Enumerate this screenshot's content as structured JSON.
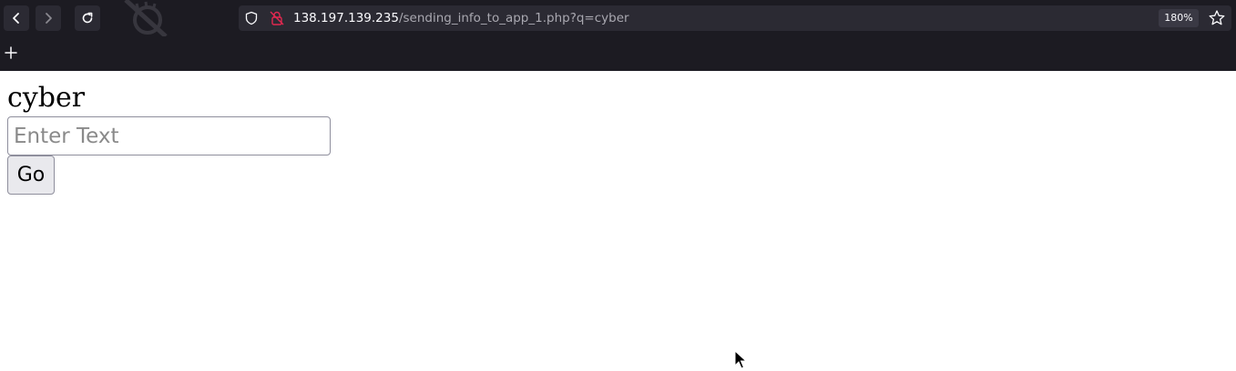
{
  "browser": {
    "url_host": "138.197.139.235",
    "url_path": "/sending_info_to_app_1.php?q=cyber",
    "zoom_level": "180%",
    "new_tab_label": "+"
  },
  "page": {
    "heading": "cyber",
    "input": {
      "value": "",
      "placeholder": "Enter Text"
    },
    "go_button_label": "Go"
  },
  "icons": {
    "back": "chevron-left-icon",
    "forward": "chevron-right-icon",
    "reload": "reload-icon",
    "tracking_protection": "shield-icon",
    "insecure": "lock-strikethrough-icon",
    "bookmark": "star-icon",
    "cursor": "mouse-pointer-icon"
  },
  "colors": {
    "chrome_bg": "#1c1b22",
    "urlbar_bg": "#2b2a33",
    "url_host_text": "#fbfbfe",
    "url_path_text": "#a9a8b0",
    "insecure_red": "#e22850",
    "page_bg": "#ffffff",
    "button_bg": "#e9e9ed"
  }
}
